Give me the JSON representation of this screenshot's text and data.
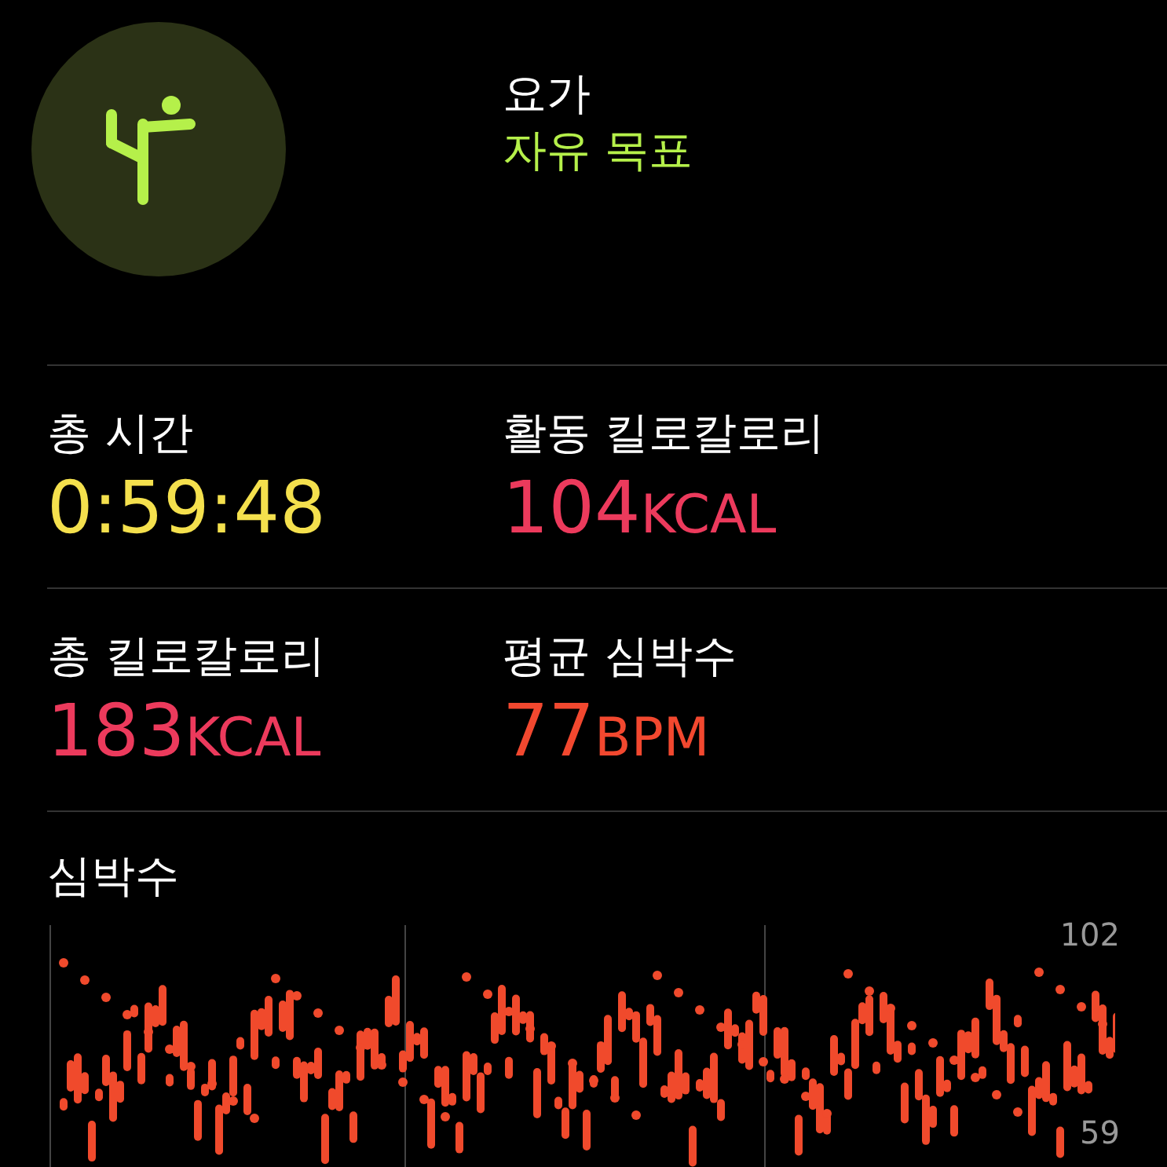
{
  "workout": {
    "title": "요가",
    "goal": "자유 목표"
  },
  "stats": [
    {
      "label": "총 시간",
      "value": "0:59:48",
      "color": "#f4e04d"
    },
    {
      "label": "활동 킬로칼로리",
      "value": "104",
      "unit": "KCAL",
      "color": "#ec3a5c"
    },
    {
      "label": "총 킬로칼로리",
      "value": "183",
      "unit": "KCAL",
      "color": "#ec3a5c"
    },
    {
      "label": "평균 심박수",
      "value": "77",
      "unit": "BPM",
      "color": "#f2482f"
    }
  ],
  "heart_rate": {
    "title": "심박수",
    "max_label": "102",
    "min_label": "59"
  }
}
